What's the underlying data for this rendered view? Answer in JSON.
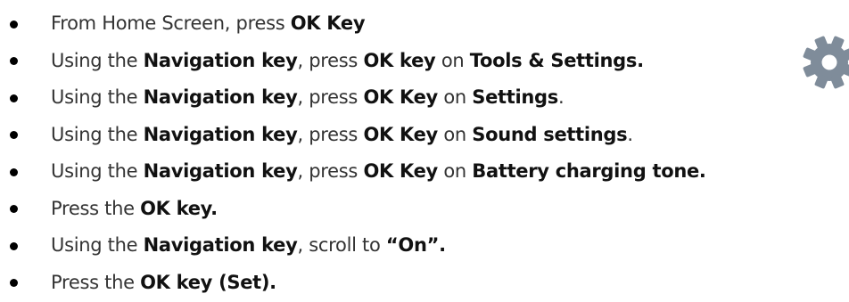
{
  "steps": [
    {
      "parts": [
        {
          "text": "From Home Screen, press ",
          "bold": false
        },
        {
          "text": "OK Key",
          "bold": true
        }
      ]
    },
    {
      "parts": [
        {
          "text": "Using the ",
          "bold": false
        },
        {
          "text": "Navigation key",
          "bold": true
        },
        {
          "text": ", press ",
          "bold": false
        },
        {
          "text": "OK key",
          "bold": true
        },
        {
          "text": " on ",
          "bold": false
        },
        {
          "text": "Tools & Settings.",
          "bold": true
        }
      ]
    },
    {
      "parts": [
        {
          "text": "Using the ",
          "bold": false
        },
        {
          "text": "Navigation key",
          "bold": true
        },
        {
          "text": ", press ",
          "bold": false
        },
        {
          "text": "OK Key",
          "bold": true
        },
        {
          "text": " on ",
          "bold": false
        },
        {
          "text": "Settings",
          "bold": true
        },
        {
          "text": ".",
          "bold": false
        }
      ]
    },
    {
      "parts": [
        {
          "text": "Using the ",
          "bold": false
        },
        {
          "text": "Navigation key",
          "bold": true
        },
        {
          "text": ", press ",
          "bold": false
        },
        {
          "text": "OK Key",
          "bold": true
        },
        {
          "text": " on ",
          "bold": false
        },
        {
          "text": "Sound settings",
          "bold": true
        },
        {
          "text": ".",
          "bold": false
        }
      ]
    },
    {
      "parts": [
        {
          "text": "Using the ",
          "bold": false
        },
        {
          "text": "Navigation key",
          "bold": true
        },
        {
          "text": ", press ",
          "bold": false
        },
        {
          "text": "OK Key",
          "bold": true
        },
        {
          "text": " on ",
          "bold": false
        },
        {
          "text": "Battery charging tone.",
          "bold": true
        }
      ]
    },
    {
      "parts": [
        {
          "text": "Press the ",
          "bold": false
        },
        {
          "text": "OK key.",
          "bold": true
        }
      ]
    },
    {
      "parts": [
        {
          "text": "Using the ",
          "bold": false
        },
        {
          "text": "Navigation key",
          "bold": true
        },
        {
          "text": ", scroll to ",
          "bold": false
        },
        {
          "text": "“On”.",
          "bold": true
        }
      ]
    },
    {
      "parts": [
        {
          "text": "Press the ",
          "bold": false
        },
        {
          "text": "OK key (Set).",
          "bold": true
        }
      ]
    }
  ],
  "icon": {
    "name": "settings-gear-icon",
    "color": "#7f8c9a"
  }
}
